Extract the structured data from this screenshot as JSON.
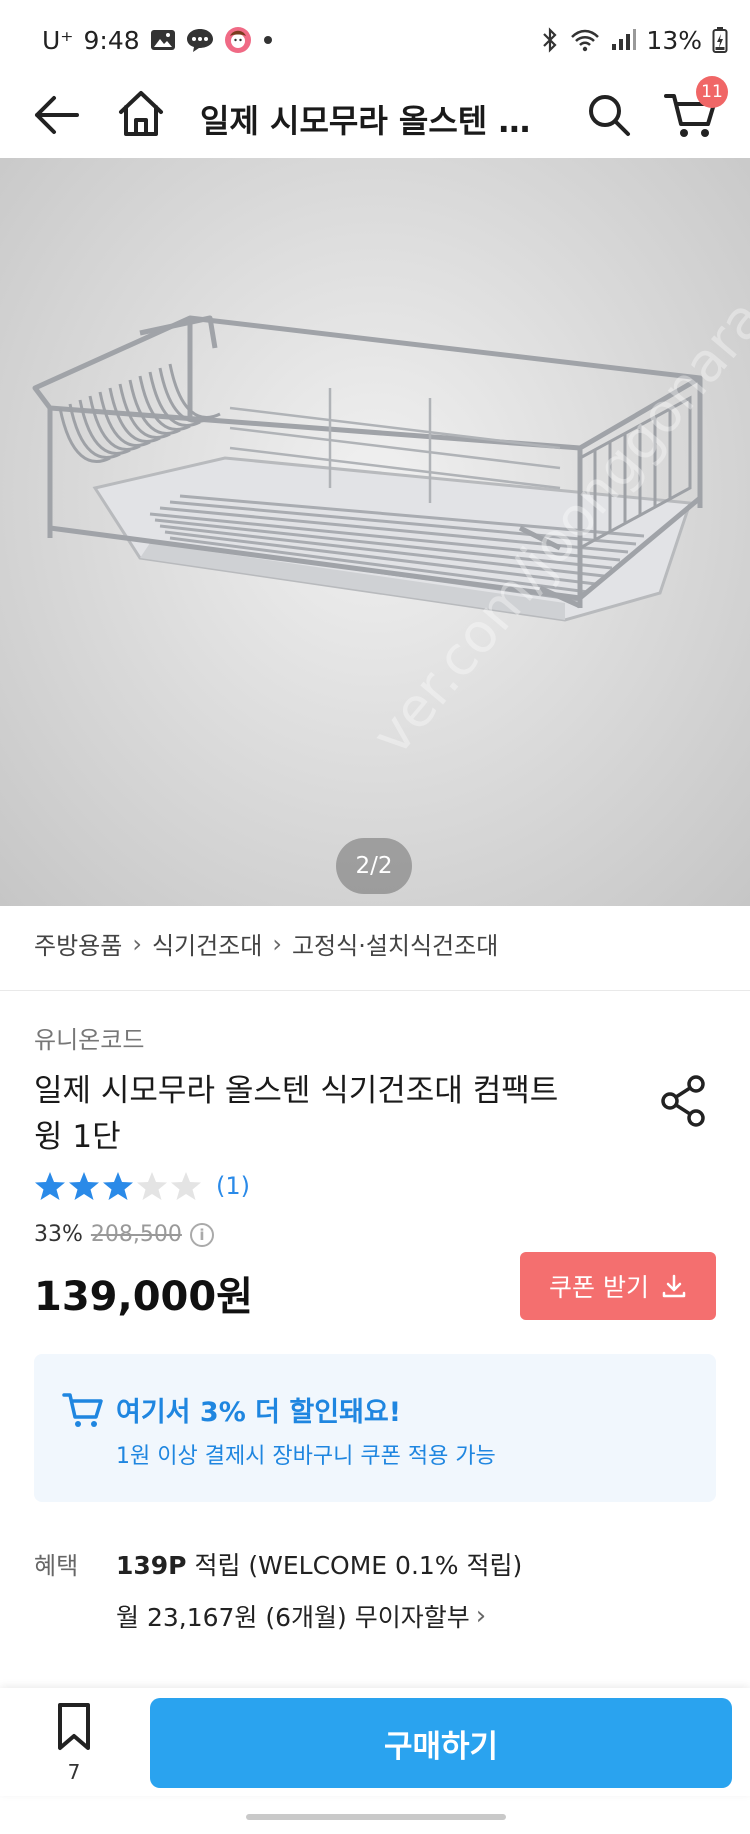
{
  "status_bar": {
    "carrier": "U⁺",
    "time": "9:48",
    "battery": "13%"
  },
  "header": {
    "title": "일제 시모무라 올스텐 식...",
    "cart_count": "11"
  },
  "gallery": {
    "counter": "2/2"
  },
  "breadcrumb": [
    "주방용품",
    "식기건조대",
    "고정식·설치식건조대"
  ],
  "product": {
    "brand": "유니온코드",
    "name_line1": "일제 시모무라 올스텐 식기건조대 컴팩트",
    "name_line2": "윙 1단",
    "rating_stars": 3,
    "rating_max": 5,
    "review_count": "(1)",
    "discount_rate": "33%",
    "original_price": "208,500",
    "price": "139,000원"
  },
  "coupon_button": {
    "label": "쿠폰 받기"
  },
  "promo": {
    "title": "여기서 3% 더 할인돼요!",
    "subtitle": "1원 이상 결제시 장바구니 쿠폰 적용 가능"
  },
  "benefits": {
    "label": "혜택",
    "points": "139P",
    "points_rest": " 적립 (WELCOME 0.1% 적립)",
    "installment": "월 23,167원 (6개월) 무이자할부"
  },
  "bottom_bar": {
    "bookmark_count": "7",
    "buy_label": "구매하기"
  },
  "colors": {
    "accent_blue": "#2aa3ef",
    "coupon_red": "#f46f6f",
    "star_blue": "#2a8ae8",
    "badge_red": "#f06666"
  }
}
